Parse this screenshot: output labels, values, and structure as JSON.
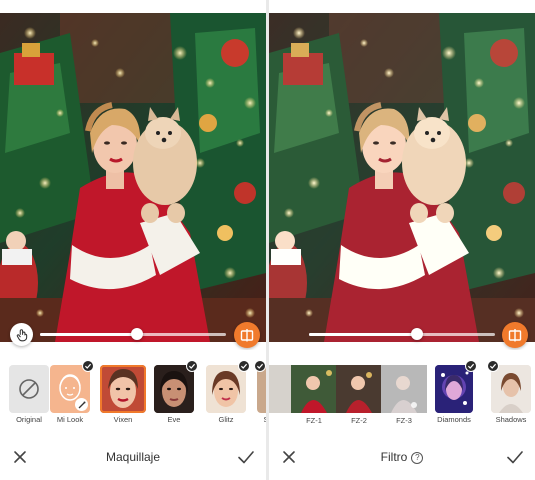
{
  "makeup_panel": {
    "title": "Maquillaje",
    "intensity": 0.52,
    "options": [
      {
        "label": "Original",
        "selected": false,
        "checked": false
      },
      {
        "label": "Mi Look",
        "selected": false,
        "checked": true
      },
      {
        "label": "Vixen",
        "selected": true,
        "checked": false
      },
      {
        "label": "Eve",
        "selected": false,
        "checked": true
      },
      {
        "label": "Glitz",
        "selected": false,
        "checked": true
      },
      {
        "label": "S",
        "selected": false,
        "checked": true
      }
    ]
  },
  "filter_panel": {
    "title": "Filtro",
    "help_symbol": "?",
    "intensity": 0.58,
    "options": [
      {
        "label": "FZ-1"
      },
      {
        "label": "FZ-2"
      },
      {
        "label": "FZ-3"
      },
      {
        "label": "Diamonds",
        "checked": true
      },
      {
        "label": "Shadows",
        "checked": true
      }
    ]
  },
  "icons": {
    "touch": "hand-touch-icon",
    "compare": "compare-split-icon",
    "close": "close-icon",
    "apply": "checkmark-icon"
  },
  "colors": {
    "accent": "#f07a2c",
    "dress_red": "#c0172a",
    "check_badge": "#2b2b2b"
  }
}
